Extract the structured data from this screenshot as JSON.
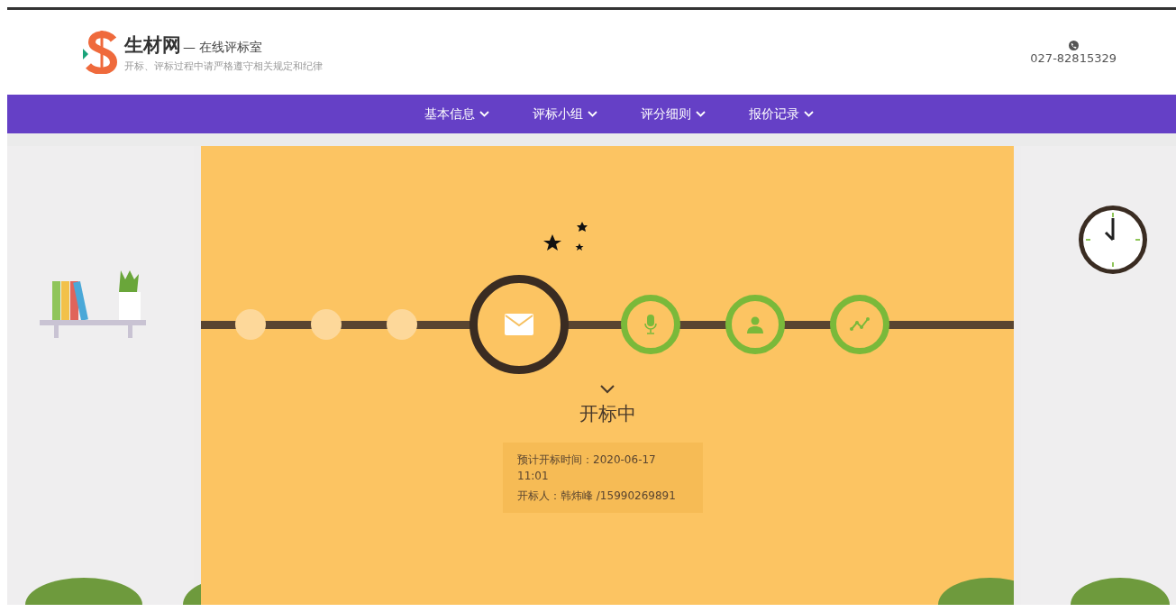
{
  "brand": {
    "name": "生材网",
    "suffix": "— 在线评标室",
    "notice": "开标、评标过程中请严格遵守相关规定和纪律"
  },
  "contact": {
    "phone": "027-82815329"
  },
  "nav": [
    {
      "label": "基本信息"
    },
    {
      "label": "评标小组"
    },
    {
      "label": "评分细则"
    },
    {
      "label": "报价记录"
    }
  ],
  "steps": [
    {
      "kind": "done"
    },
    {
      "kind": "done"
    },
    {
      "kind": "done"
    },
    {
      "kind": "current"
    },
    {
      "kind": "pending"
    },
    {
      "kind": "pending"
    },
    {
      "kind": "pending"
    }
  ],
  "status": {
    "title": "开标中",
    "lines": [
      "预计开标时间：2020-06-17 11:01",
      "开标人：韩炜峰 /15990269891"
    ]
  }
}
